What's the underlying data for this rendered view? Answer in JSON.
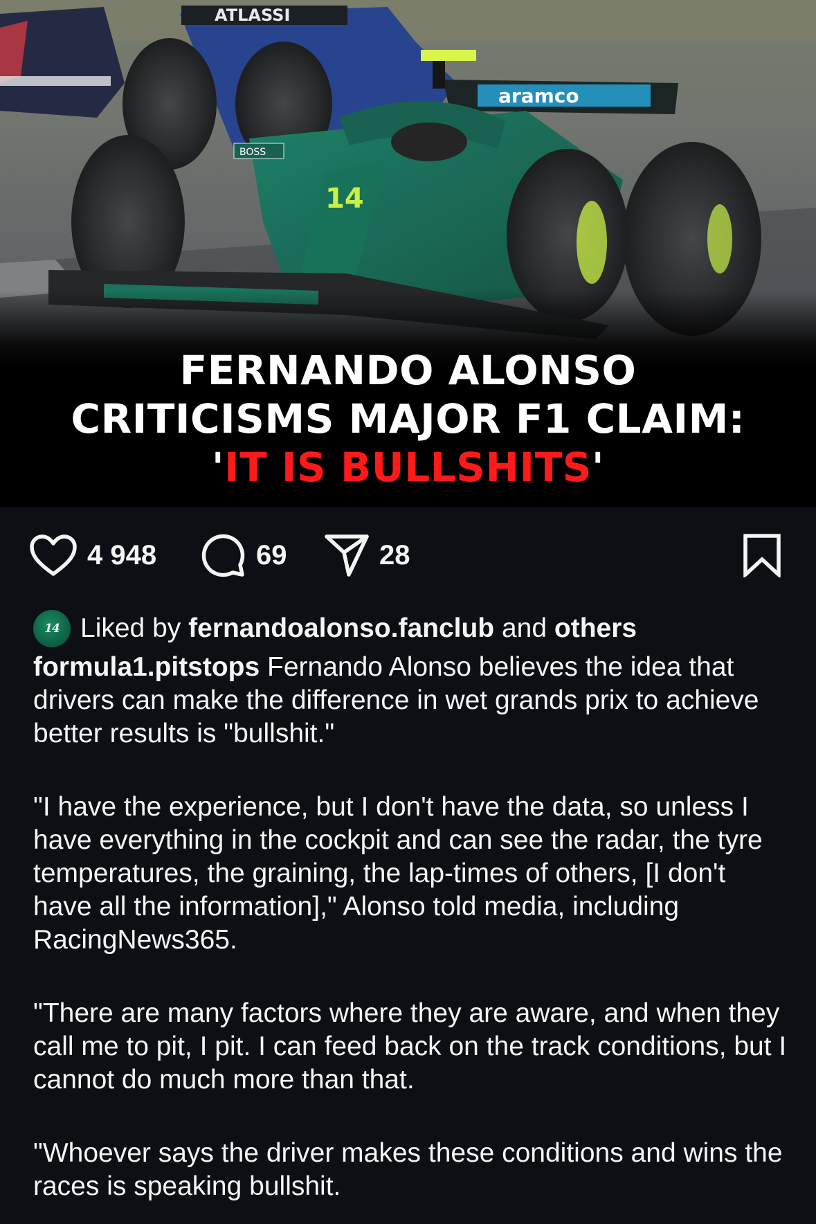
{
  "hero": {
    "headline_line1": "FERNANDO ALONSO",
    "headline_line2": "CRITICISMS MAJOR F1 CLAIM:",
    "headline_quote_open": "'",
    "headline_highlight": "IT IS BULLSHITS",
    "headline_quote_close": "'",
    "highlight_color": "#ff1a1a",
    "car_number": "14",
    "sponsor_text": "ATLASSI",
    "wing_text": "aramco",
    "boss_label": "BOSS"
  },
  "actions": {
    "like_icon": "heart-icon",
    "like_count": "4 948",
    "comment_icon": "comment-bubble-icon",
    "comment_count": "69",
    "share_icon": "paper-plane-icon",
    "share_count": "28",
    "save_icon": "bookmark-icon"
  },
  "liked_by": {
    "avatar_text": "14",
    "prefix": "Liked by",
    "user": "fernandoalonso.fanclub",
    "connector": "and",
    "others": "others"
  },
  "caption": {
    "username": "formula1.pitstops",
    "text": "Fernando Alonso believes the idea that drivers can make the difference in wet grands prix to achieve better results is \"bullshit.\"",
    "paragraphs": [
      "\"I have the experience, but I don't have the data, so unless I have everything in the cockpit and can see the radar, the tyre temperatures, the graining, the lap-times of others, [I don't have all the information],\" Alonso told media, including RacingNews365.",
      "\"There are many factors where they are aware, and when they call me to pit, I pit. I can feed back on the track conditions, but I cannot do much more than that.",
      "\"Whoever says the driver makes these conditions and wins the races is speaking bullshit."
    ]
  },
  "colors": {
    "background": "#0c0f14",
    "text": "#f5f5f5",
    "car_green": "#0f6b55",
    "tyre_accent": "#c8f03c"
  }
}
